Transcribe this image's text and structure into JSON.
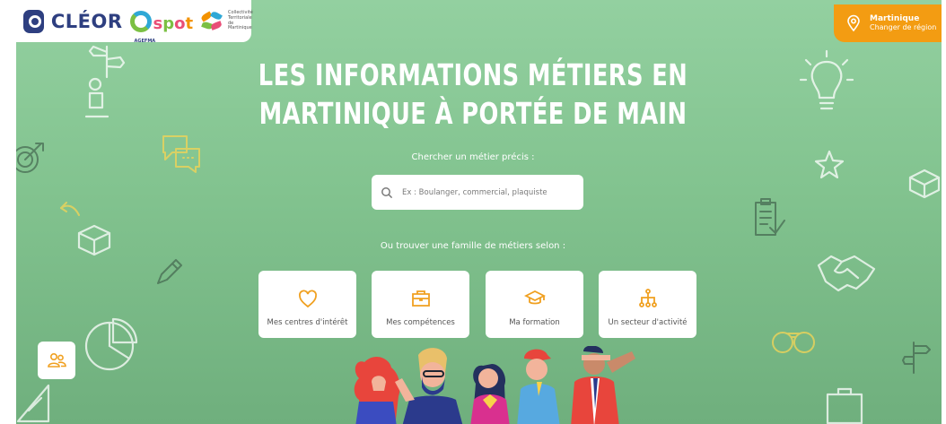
{
  "header": {
    "brand": "CLÉOR",
    "partner_spot": "spot",
    "partner_agefma": "AGEFMA",
    "partner_ctm": "Collectivité Territoriale de Martinique"
  },
  "region": {
    "name": "Martinique",
    "change_label": "Changer de région",
    "icon": "location-pin-icon"
  },
  "hero": {
    "title_line1": "LES INFORMATIONS MÉTIERS EN",
    "title_line2": "MARTINIQUE À PORTÉE DE MAIN"
  },
  "search": {
    "label": "Chercher un métier précis :",
    "placeholder": "Ex : Boulanger, commercial, plaquiste",
    "icon": "search-icon"
  },
  "families": {
    "label": "Ou trouver une famille de métiers selon :",
    "items": [
      {
        "label": "Mes centres d'intérêt",
        "icon": "heart-icon"
      },
      {
        "label": "Mes compétences",
        "icon": "briefcase-icon"
      },
      {
        "label": "Ma formation",
        "icon": "graduation-cap-icon"
      },
      {
        "label": "Un secteur d'activité",
        "icon": "org-chart-icon"
      }
    ]
  },
  "side_button": {
    "icon": "users-icon"
  },
  "colors": {
    "background": "#82c38f",
    "accent_orange": "#f39c12",
    "icon_orange": "#f0a020",
    "brand_navy": "#2e3f80",
    "card": "#ffffff"
  }
}
